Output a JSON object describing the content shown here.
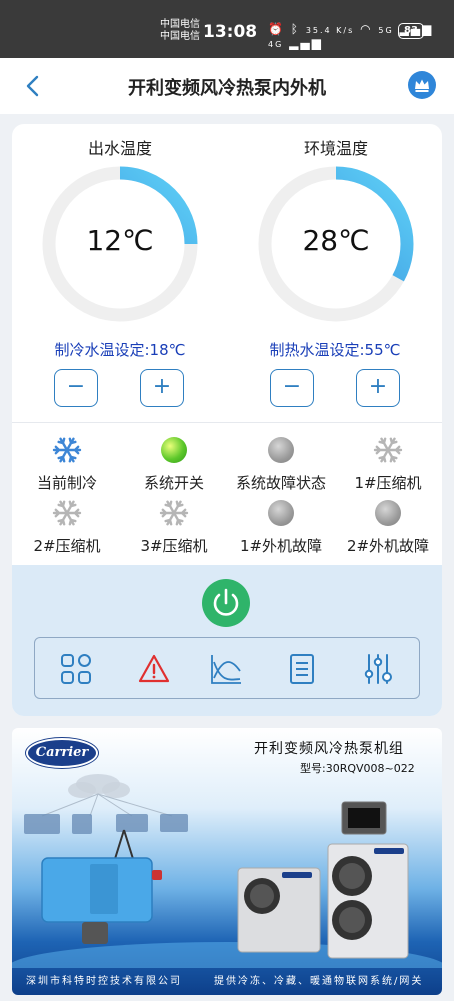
{
  "status_bar": {
    "carrier_1": "中国电信",
    "carrier_2": "中国电信",
    "time": "13:08",
    "network_speed": "35.4 K/s",
    "signal_1": "5G",
    "signal_2": "4G",
    "battery": "83"
  },
  "header": {
    "title": "开利变频风冷热泵内外机",
    "back_icon": "chevron-left-icon",
    "vip_icon": "crown-icon"
  },
  "gauges": [
    {
      "title": "出水温度",
      "value": "12℃",
      "fill": 0.25
    },
    {
      "title": "环境温度",
      "value": "28℃",
      "fill": 0.33
    }
  ],
  "setpoints": [
    {
      "label": "制冷水温设定:18℃",
      "minus": "−",
      "plus": "+"
    },
    {
      "label": "制热水温设定:55℃",
      "minus": "−",
      "plus": "+"
    }
  ],
  "status_items": [
    {
      "label": "当前制冷",
      "icon": "snowflake-icon",
      "color": "#3d86d6"
    },
    {
      "label": "系统开关",
      "icon": "indicator-green",
      "color": "#4fbf2a"
    },
    {
      "label": "系统故障状态",
      "icon": "indicator-grey",
      "color": "#9a9a9a"
    },
    {
      "label": "1#压缩机",
      "icon": "snowflake-icon",
      "color": "#b5b5b5"
    },
    {
      "label": "2#压缩机",
      "icon": "snowflake-icon",
      "color": "#b5b5b5"
    },
    {
      "label": "3#压缩机",
      "icon": "snowflake-icon",
      "color": "#b5b5b5"
    },
    {
      "label": "1#外机故障",
      "icon": "indicator-grey",
      "color": "#9a9a9a"
    },
    {
      "label": "2#外机故障",
      "icon": "indicator-grey",
      "color": "#9a9a9a"
    }
  ],
  "toolbar": {
    "power_icon": "power-icon",
    "tools": [
      "grid-icon",
      "alert-triangle-icon",
      "chart-icon",
      "list-icon",
      "sliders-icon"
    ]
  },
  "banner": {
    "logo": "Carrier",
    "title": "开利变频风冷热泵机组",
    "model": "型号:30RQV008~022",
    "footer_left": "深圳市科特时控技术有限公司",
    "footer_right": "提供冷冻、冷藏、暖通物联网系统/网关"
  },
  "colors": {
    "accent": "#2f7fc1",
    "gauge_arc": "#38b6f0",
    "setpoint_text": "#1a3fb8",
    "power": "#2fb46a",
    "alert": "#e03030"
  }
}
